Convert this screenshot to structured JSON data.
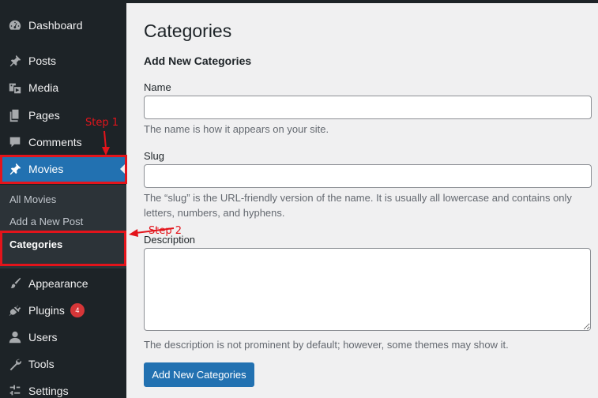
{
  "sidebar": {
    "items": [
      {
        "label": "Dashboard",
        "icon": "dashboard-icon"
      },
      {
        "label": "Posts",
        "icon": "pin-icon"
      },
      {
        "label": "Media",
        "icon": "media-icon"
      },
      {
        "label": "Pages",
        "icon": "pages-icon"
      },
      {
        "label": "Comments",
        "icon": "comment-icon"
      },
      {
        "label": "Movies",
        "icon": "pin-icon",
        "active": true
      },
      {
        "label": "Appearance",
        "icon": "brush-icon"
      },
      {
        "label": "Plugins",
        "icon": "plugin-icon",
        "badge": "4"
      },
      {
        "label": "Users",
        "icon": "user-icon"
      },
      {
        "label": "Tools",
        "icon": "wrench-icon"
      },
      {
        "label": "Settings",
        "icon": "settings-icon"
      }
    ],
    "submenu": [
      {
        "label": "All Movies"
      },
      {
        "label": "Add a New Post"
      },
      {
        "label": "Categories",
        "current": true
      }
    ]
  },
  "annotations": {
    "step1": "Step 1",
    "step2": "Step 2"
  },
  "main": {
    "page_title": "Categories",
    "section_title": "Add New Categories",
    "name_label": "Name",
    "name_value": "",
    "name_help": "The name is how it appears on your site.",
    "slug_label": "Slug",
    "slug_value": "",
    "slug_help": "The “slug” is the URL-friendly version of the name. It is usually all lowercase and contains only letters, numbers, and hyphens.",
    "description_label": "Description",
    "description_value": "",
    "description_help": "The description is not prominent by default; however, some themes may show it.",
    "submit_label": "Add New Categories"
  },
  "colors": {
    "sidebar_bg": "#1d2327",
    "accent": "#2271b1",
    "annotation": "#e3141b",
    "badge": "#d63638"
  }
}
